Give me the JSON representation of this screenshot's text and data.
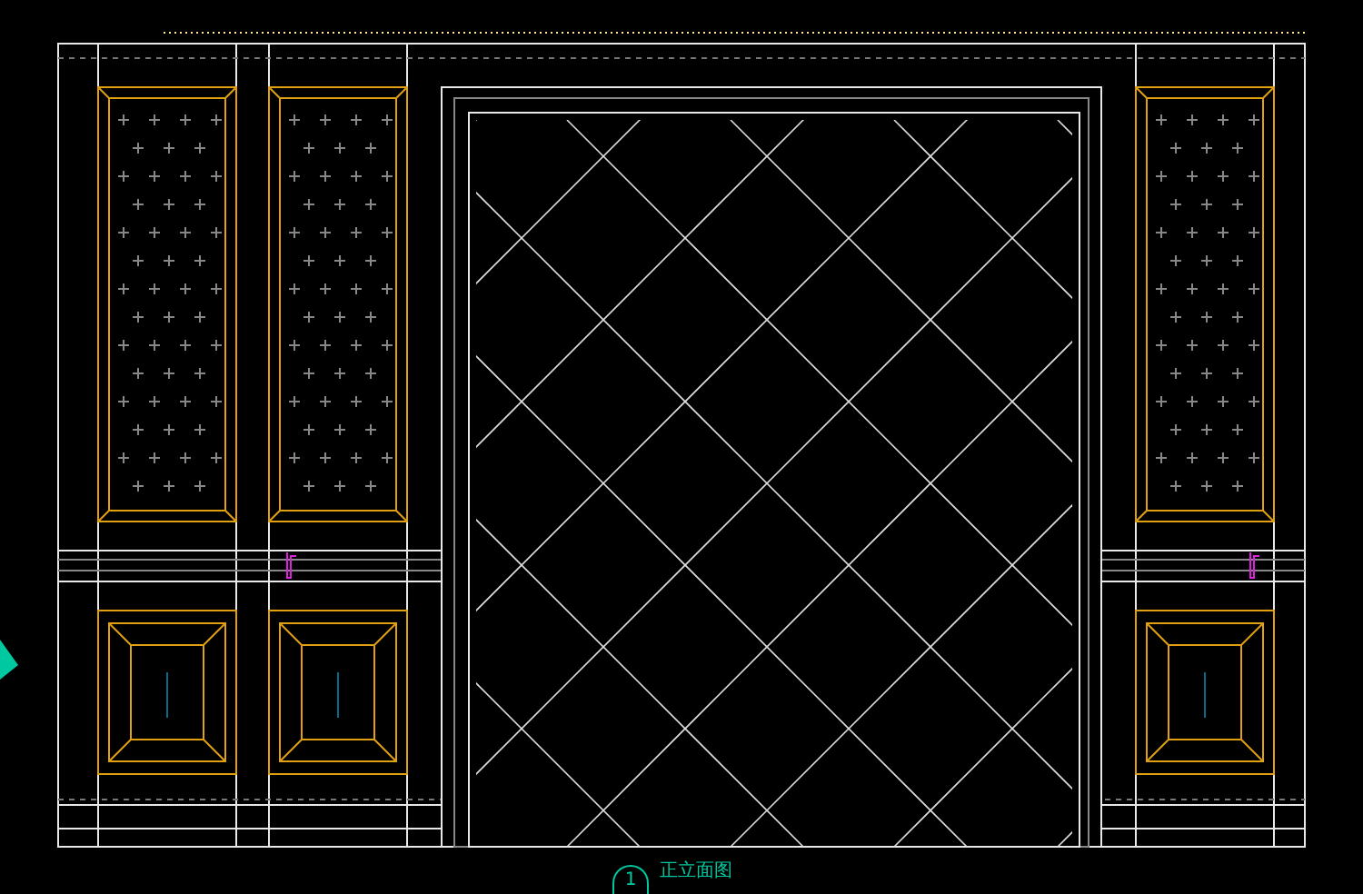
{
  "drawing_title": {
    "number": "1",
    "label": "正立面图"
  }
}
